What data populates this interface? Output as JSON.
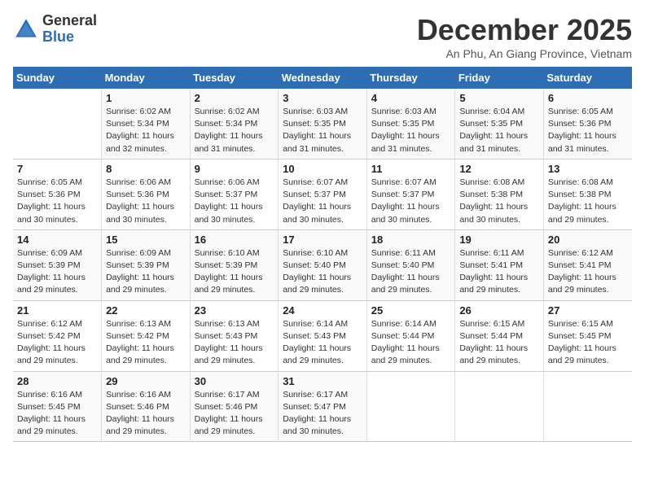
{
  "logo": {
    "general": "General",
    "blue": "Blue"
  },
  "header": {
    "month_year": "December 2025",
    "location": "An Phu, An Giang Province, Vietnam"
  },
  "days_of_week": [
    "Sunday",
    "Monday",
    "Tuesday",
    "Wednesday",
    "Thursday",
    "Friday",
    "Saturday"
  ],
  "weeks": [
    [
      {
        "day": "",
        "detail": ""
      },
      {
        "day": "1",
        "detail": "Sunrise: 6:02 AM\nSunset: 5:34 PM\nDaylight: 11 hours\nand 32 minutes."
      },
      {
        "day": "2",
        "detail": "Sunrise: 6:02 AM\nSunset: 5:34 PM\nDaylight: 11 hours\nand 31 minutes."
      },
      {
        "day": "3",
        "detail": "Sunrise: 6:03 AM\nSunset: 5:35 PM\nDaylight: 11 hours\nand 31 minutes."
      },
      {
        "day": "4",
        "detail": "Sunrise: 6:03 AM\nSunset: 5:35 PM\nDaylight: 11 hours\nand 31 minutes."
      },
      {
        "day": "5",
        "detail": "Sunrise: 6:04 AM\nSunset: 5:35 PM\nDaylight: 11 hours\nand 31 minutes."
      },
      {
        "day": "6",
        "detail": "Sunrise: 6:05 AM\nSunset: 5:36 PM\nDaylight: 11 hours\nand 31 minutes."
      }
    ],
    [
      {
        "day": "7",
        "detail": "Sunrise: 6:05 AM\nSunset: 5:36 PM\nDaylight: 11 hours\nand 30 minutes."
      },
      {
        "day": "8",
        "detail": "Sunrise: 6:06 AM\nSunset: 5:36 PM\nDaylight: 11 hours\nand 30 minutes."
      },
      {
        "day": "9",
        "detail": "Sunrise: 6:06 AM\nSunset: 5:37 PM\nDaylight: 11 hours\nand 30 minutes."
      },
      {
        "day": "10",
        "detail": "Sunrise: 6:07 AM\nSunset: 5:37 PM\nDaylight: 11 hours\nand 30 minutes."
      },
      {
        "day": "11",
        "detail": "Sunrise: 6:07 AM\nSunset: 5:37 PM\nDaylight: 11 hours\nand 30 minutes."
      },
      {
        "day": "12",
        "detail": "Sunrise: 6:08 AM\nSunset: 5:38 PM\nDaylight: 11 hours\nand 30 minutes."
      },
      {
        "day": "13",
        "detail": "Sunrise: 6:08 AM\nSunset: 5:38 PM\nDaylight: 11 hours\nand 29 minutes."
      }
    ],
    [
      {
        "day": "14",
        "detail": "Sunrise: 6:09 AM\nSunset: 5:39 PM\nDaylight: 11 hours\nand 29 minutes."
      },
      {
        "day": "15",
        "detail": "Sunrise: 6:09 AM\nSunset: 5:39 PM\nDaylight: 11 hours\nand 29 minutes."
      },
      {
        "day": "16",
        "detail": "Sunrise: 6:10 AM\nSunset: 5:39 PM\nDaylight: 11 hours\nand 29 minutes."
      },
      {
        "day": "17",
        "detail": "Sunrise: 6:10 AM\nSunset: 5:40 PM\nDaylight: 11 hours\nand 29 minutes."
      },
      {
        "day": "18",
        "detail": "Sunrise: 6:11 AM\nSunset: 5:40 PM\nDaylight: 11 hours\nand 29 minutes."
      },
      {
        "day": "19",
        "detail": "Sunrise: 6:11 AM\nSunset: 5:41 PM\nDaylight: 11 hours\nand 29 minutes."
      },
      {
        "day": "20",
        "detail": "Sunrise: 6:12 AM\nSunset: 5:41 PM\nDaylight: 11 hours\nand 29 minutes."
      }
    ],
    [
      {
        "day": "21",
        "detail": "Sunrise: 6:12 AM\nSunset: 5:42 PM\nDaylight: 11 hours\nand 29 minutes."
      },
      {
        "day": "22",
        "detail": "Sunrise: 6:13 AM\nSunset: 5:42 PM\nDaylight: 11 hours\nand 29 minutes."
      },
      {
        "day": "23",
        "detail": "Sunrise: 6:13 AM\nSunset: 5:43 PM\nDaylight: 11 hours\nand 29 minutes."
      },
      {
        "day": "24",
        "detail": "Sunrise: 6:14 AM\nSunset: 5:43 PM\nDaylight: 11 hours\nand 29 minutes."
      },
      {
        "day": "25",
        "detail": "Sunrise: 6:14 AM\nSunset: 5:44 PM\nDaylight: 11 hours\nand 29 minutes."
      },
      {
        "day": "26",
        "detail": "Sunrise: 6:15 AM\nSunset: 5:44 PM\nDaylight: 11 hours\nand 29 minutes."
      },
      {
        "day": "27",
        "detail": "Sunrise: 6:15 AM\nSunset: 5:45 PM\nDaylight: 11 hours\nand 29 minutes."
      }
    ],
    [
      {
        "day": "28",
        "detail": "Sunrise: 6:16 AM\nSunset: 5:45 PM\nDaylight: 11 hours\nand 29 minutes."
      },
      {
        "day": "29",
        "detail": "Sunrise: 6:16 AM\nSunset: 5:46 PM\nDaylight: 11 hours\nand 29 minutes."
      },
      {
        "day": "30",
        "detail": "Sunrise: 6:17 AM\nSunset: 5:46 PM\nDaylight: 11 hours\nand 29 minutes."
      },
      {
        "day": "31",
        "detail": "Sunrise: 6:17 AM\nSunset: 5:47 PM\nDaylight: 11 hours\nand 30 minutes."
      },
      {
        "day": "",
        "detail": ""
      },
      {
        "day": "",
        "detail": ""
      },
      {
        "day": "",
        "detail": ""
      }
    ]
  ]
}
